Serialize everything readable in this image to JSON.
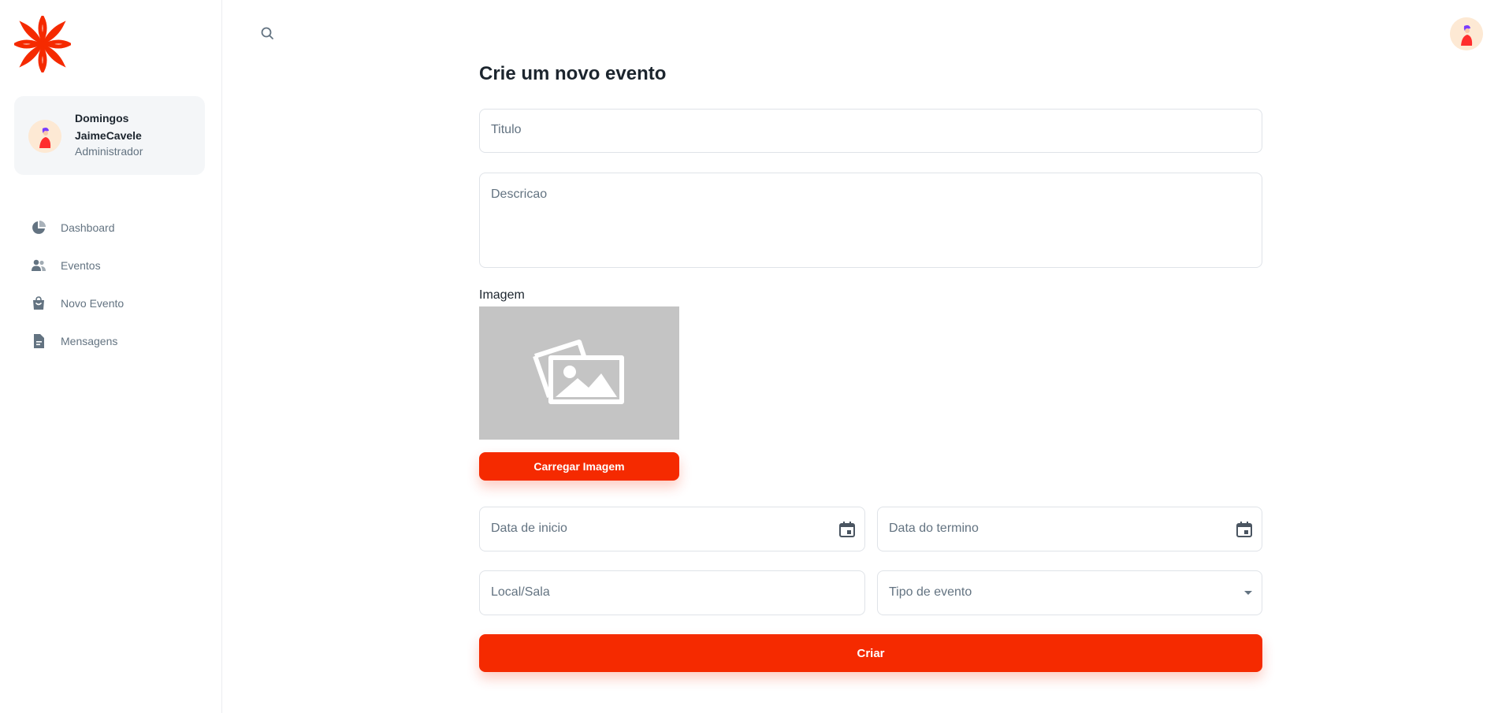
{
  "colors": {
    "accent": "#f52a00",
    "sidebar_text": "#637381",
    "text": "#1c252e",
    "card_bg": "#f4f6f8"
  },
  "sidebar": {
    "logo_icon": "sunburst-logo-icon",
    "user": {
      "name": "Domingos JaimeCavele",
      "role": "Administrador"
    },
    "items": [
      {
        "label": "Dashboard",
        "icon": "pie-chart-icon"
      },
      {
        "label": "Eventos",
        "icon": "users-icon"
      },
      {
        "label": "Novo Evento",
        "icon": "shopping-bag-icon"
      },
      {
        "label": "Mensagens",
        "icon": "document-icon"
      }
    ]
  },
  "header": {
    "search_icon": "search-icon",
    "avatar_icon": "avatar-icon"
  },
  "form": {
    "title": "Crie um novo evento",
    "titulo_placeholder": "Titulo",
    "descricao_placeholder": "Descricao",
    "image_label": "Imagem",
    "image_placeholder_icon": "image-placeholder-icon",
    "upload_button": "Carregar Imagem",
    "start_date_placeholder": "Data de inicio",
    "end_date_placeholder": "Data do termino",
    "local_placeholder": "Local/Sala",
    "tipo_placeholder": "Tipo de evento",
    "submit_button": "Criar"
  }
}
